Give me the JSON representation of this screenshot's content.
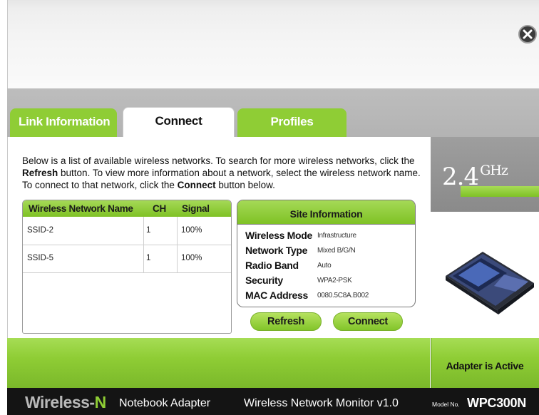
{
  "tabs": [
    {
      "label": "Link Information"
    },
    {
      "label": "Connect"
    },
    {
      "label": "Profiles"
    }
  ],
  "intro": {
    "part1": "Below is a list of available wireless networks. To search for more wireless networks, click the ",
    "refresh_word": "Refresh",
    "part2": " button. To view more information about a network, select the wireless network name. To connect to that network, click the ",
    "connect_word": "Connect",
    "part3": " button below."
  },
  "networks": {
    "columns": [
      "Wireless Network Name",
      "CH",
      "Signal"
    ],
    "rows": [
      {
        "name": "SSID-2",
        "ch": "1",
        "signal": "100%"
      },
      {
        "name": "SSID-5",
        "ch": "1",
        "signal": "100%"
      }
    ]
  },
  "site_info": {
    "title": "Site Information",
    "rows": [
      {
        "label": "Wireless Mode",
        "value": "Infrastructure"
      },
      {
        "label": "Network Type",
        "value": "Mixed B/G/N"
      },
      {
        "label": "Radio Band",
        "value": "Auto"
      },
      {
        "label": "Security",
        "value": "WPA2-PSK"
      },
      {
        "label": "MAC Address",
        "value": "0080.5C8A.B002"
      }
    ]
  },
  "buttons": {
    "refresh": "Refresh",
    "connect": "Connect"
  },
  "side": {
    "ghz_number": "2.4",
    "ghz_unit": "GHz",
    "status": "Adapter is Active"
  },
  "footer": {
    "wireless": "Wireless-",
    "n": "N",
    "adapter": "Notebook Adapter",
    "monitor": "Wireless Network Monitor  v1.0",
    "model_no": "Model No.",
    "model": "WPC300N"
  },
  "colors": {
    "accent_green": "#8fcd35",
    "footer_bg": "#141414",
    "gray_band": "#b3b3b3"
  },
  "icons": {
    "close": "close-icon",
    "card": "pc-card-adapter-image"
  }
}
